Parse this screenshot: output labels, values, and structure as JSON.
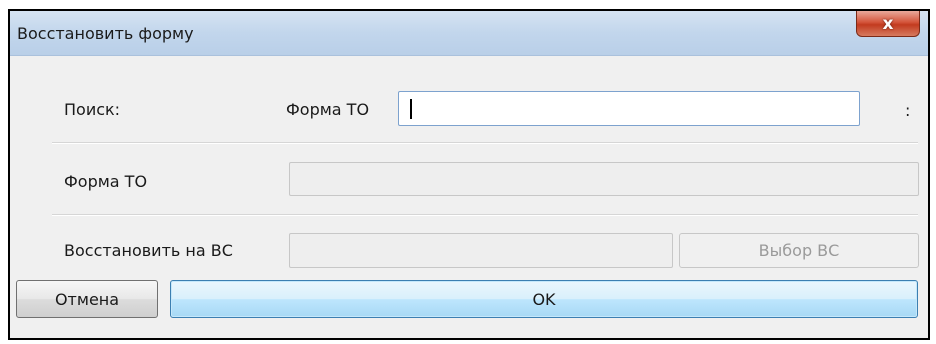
{
  "window": {
    "title": "Восстановить форму",
    "close_glyph": "x"
  },
  "search": {
    "label": "Поиск:",
    "field_label": "Форма ТО",
    "value": "",
    "trailing": ":"
  },
  "form_to": {
    "label": "Форма ТО",
    "value": ""
  },
  "restore": {
    "label": "Восстановить на ВС",
    "value": "",
    "select_button": "Выбор ВС"
  },
  "buttons": {
    "cancel": "Отмена",
    "ok": "OK"
  }
}
